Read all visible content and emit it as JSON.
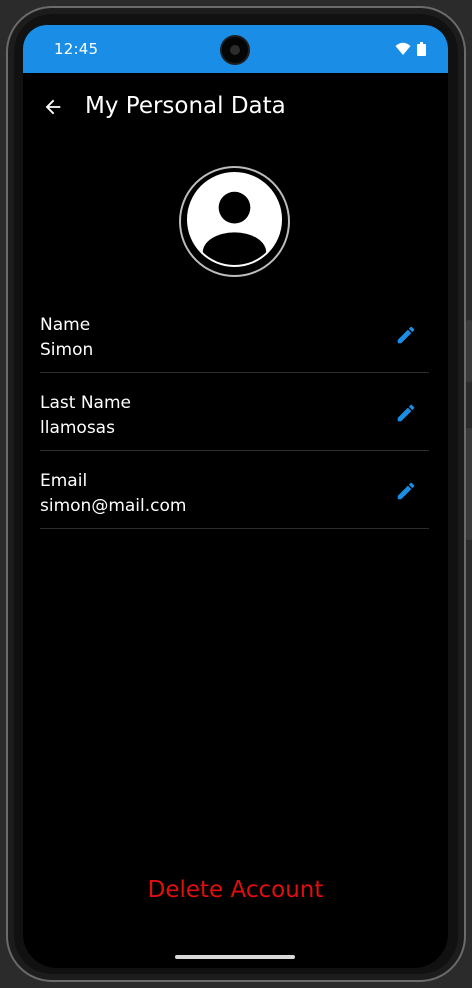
{
  "status_bar": {
    "time": "12:45",
    "icons": [
      "wifi-icon",
      "battery-icon"
    ],
    "color": "#1a8ee6"
  },
  "header": {
    "back_icon": "arrow-left-icon",
    "title": "My Personal Data"
  },
  "profile": {
    "avatar_icon": "account-circle-icon"
  },
  "fields": [
    {
      "label": "Name",
      "value": "Simon",
      "edit_icon": "pencil-icon"
    },
    {
      "label": "Last Name",
      "value": "llamosas",
      "edit_icon": "pencil-icon"
    },
    {
      "label": "Email",
      "value": "simon@mail.com",
      "edit_icon": "pencil-icon"
    }
  ],
  "actions": {
    "delete_label": "Delete Account",
    "delete_color": "#e10e0e"
  },
  "colors": {
    "accent": "#1a8ee6",
    "background": "#000000",
    "text": "#ffffff"
  }
}
